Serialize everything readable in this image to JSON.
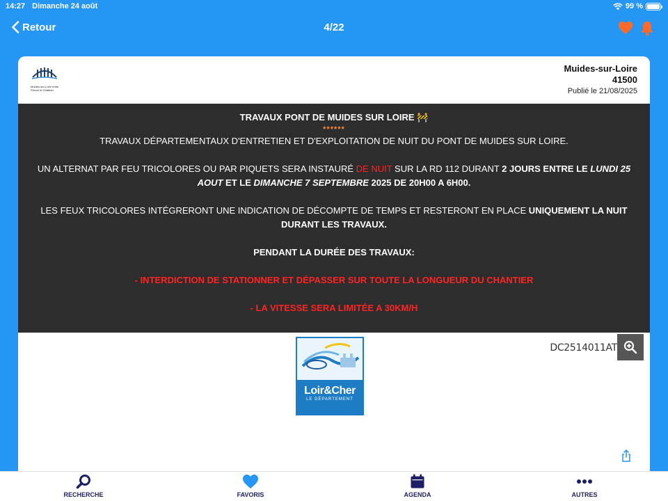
{
  "status": {
    "time": "14:27",
    "date": "Dimanche 24 août",
    "battery": "99 %",
    "battery_level": 0.99
  },
  "nav": {
    "back_label": "Retour",
    "pager": "4/22"
  },
  "card": {
    "city": "Muides-sur-Loire",
    "zip": "41500",
    "published": "Publié le 21/08/2025",
    "logo_text": "Muides-sur-Loire entre Fleuve et Château"
  },
  "notice": {
    "title": "TRAVAUX PONT DE MUIDES SUR LOIRE",
    "title_emoji": "🚧",
    "stars": "******",
    "p1": "TRAVAUX DÉPARTEMENTAUX D'ENTRETIEN ET D'EXPLOITATION DE NUIT DU PONT DE MUIDES SUR LOIRE.",
    "p2_a": "UN ALTERNAT PAR FEU TRICOLORES OU PAR PIQUETS SERA INSTAURÉ ",
    "p2_red": "DE NUIT",
    "p2_b": " SUR LA RD 112 DURANT ",
    "p2_bold1": "2 JOURS ENTRE LE ",
    "p2_bi1": "LUNDI 25 AOUT",
    "p2_bold2": " ET LE ",
    "p2_bi2": "DIMANCHE 7 SEPTEMBRE",
    "p2_bold3": " 2025 DE 20H00 A 6H00.",
    "p3_a": "LES FEUX TRICOLORES INTÉGRERONT UNE INDICATION DE DÉCOMPTE DE TEMPS ET RESTERONT EN PLACE ",
    "p3_bold": "UNIQUEMENT LA NUIT DURANT LES TRAVAUX.",
    "p4": "PENDANT LA DURÉE DES TRAVAUX:",
    "p5": "- INTERDICTION DE STATIONNER ET DÉPASSER SUR TOUTE LA LONGUEUR DU CHANTIER",
    "p6": "- LA VITESSE SERA LIMITÉE A 30KM/H"
  },
  "attachment": {
    "ref": "DC2514011AT",
    "logo_name": "Loir&Cher",
    "logo_sub": "LE DÉPARTEMENT"
  },
  "tabs": [
    {
      "label": "RECHERCHE",
      "icon": "search-icon"
    },
    {
      "label": "FAVORIS",
      "icon": "heart-icon"
    },
    {
      "label": "AGENDA",
      "icon": "calendar-icon"
    },
    {
      "label": "AUTRES",
      "icon": "more-icon"
    }
  ],
  "colors": {
    "primary": "#2596f3",
    "accent_orange": "#ff6a2b",
    "tab_text": "#1d1f66",
    "alert_red": "#ff2424",
    "notice_bg": "#2d2d2d"
  }
}
